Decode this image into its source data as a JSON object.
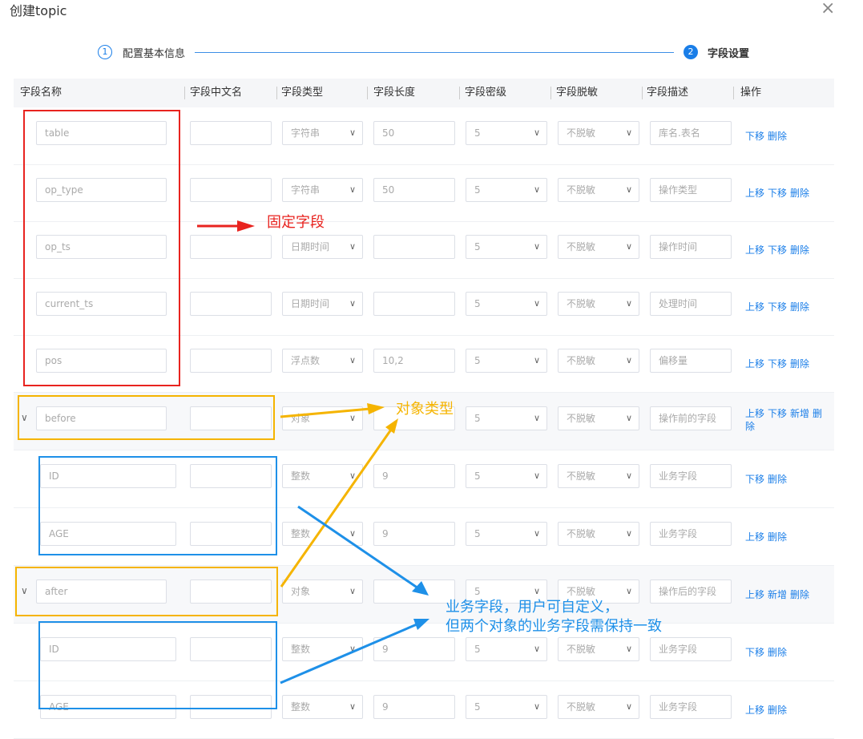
{
  "dialog": {
    "title": "创建topic",
    "close": "×"
  },
  "steps": [
    {
      "number": "1",
      "label": "配置基本信息"
    },
    {
      "number": "2",
      "label": "字段设置"
    }
  ],
  "columns": [
    "字段名称",
    "字段中文名",
    "字段类型",
    "字段长度",
    "字段密级",
    "字段脱敏",
    "字段描述",
    "操作"
  ],
  "rows": [
    {
      "name": "table",
      "cn": "",
      "type": "字符串",
      "length": "50",
      "level": "5",
      "mask": "不脱敏",
      "desc": "库名.表名",
      "ops": [
        "下移",
        "删除"
      ]
    },
    {
      "name": "op_type",
      "cn": "",
      "type": "字符串",
      "length": "50",
      "level": "5",
      "mask": "不脱敏",
      "desc": "操作类型",
      "ops": [
        "上移",
        "下移",
        "删除"
      ]
    },
    {
      "name": "op_ts",
      "cn": "",
      "type": "日期时间",
      "length": "",
      "level": "5",
      "mask": "不脱敏",
      "desc": "操作时间",
      "ops": [
        "上移",
        "下移",
        "删除"
      ]
    },
    {
      "name": "current_ts",
      "cn": "",
      "type": "日期时间",
      "length": "",
      "level": "5",
      "mask": "不脱敏",
      "desc": "处理时间",
      "ops": [
        "上移",
        "下移",
        "删除"
      ]
    },
    {
      "name": "pos",
      "cn": "",
      "type": "浮点数",
      "length": "10,2",
      "level": "5",
      "mask": "不脱敏",
      "desc": "偏移量",
      "ops": [
        "上移",
        "下移",
        "删除"
      ]
    },
    {
      "name": "before",
      "cn": "",
      "type": "对象",
      "length": "",
      "level": "5",
      "mask": "不脱敏",
      "desc": "操作前的字段",
      "ops": [
        "上移",
        "下移",
        "新增",
        "删除"
      ]
    },
    {
      "name": "ID",
      "cn": "",
      "type": "整数",
      "length": "9",
      "level": "5",
      "mask": "不脱敏",
      "desc": "业务字段",
      "ops": [
        "下移",
        "删除"
      ]
    },
    {
      "name": "AGE",
      "cn": "",
      "type": "整数",
      "length": "9",
      "level": "5",
      "mask": "不脱敏",
      "desc": "业务字段",
      "ops": [
        "上移",
        "删除"
      ]
    },
    {
      "name": "after",
      "cn": "",
      "type": "对象",
      "length": "",
      "level": "5",
      "mask": "不脱敏",
      "desc": "操作后的字段",
      "ops": [
        "上移",
        "新增",
        "删除"
      ]
    },
    {
      "name": "ID",
      "cn": "",
      "type": "整数",
      "length": "9",
      "level": "5",
      "mask": "不脱敏",
      "desc": "业务字段",
      "ops": [
        "下移",
        "删除"
      ]
    },
    {
      "name": "AGE",
      "cn": "",
      "type": "整数",
      "length": "9",
      "level": "5",
      "mask": "不脱敏",
      "desc": "业务字段",
      "ops": [
        "上移",
        "删除"
      ]
    }
  ],
  "annotations": {
    "fixed": "固定字段",
    "object": "对象类型",
    "business_line1": "业务字段，用户可自定义，",
    "business_line2": "但两个对象的业务字段需保持一致"
  },
  "colors": {
    "accent": "#1a7ee8",
    "red": "#e8231f",
    "yellow": "#f5b400",
    "blue": "#1e90e8"
  }
}
